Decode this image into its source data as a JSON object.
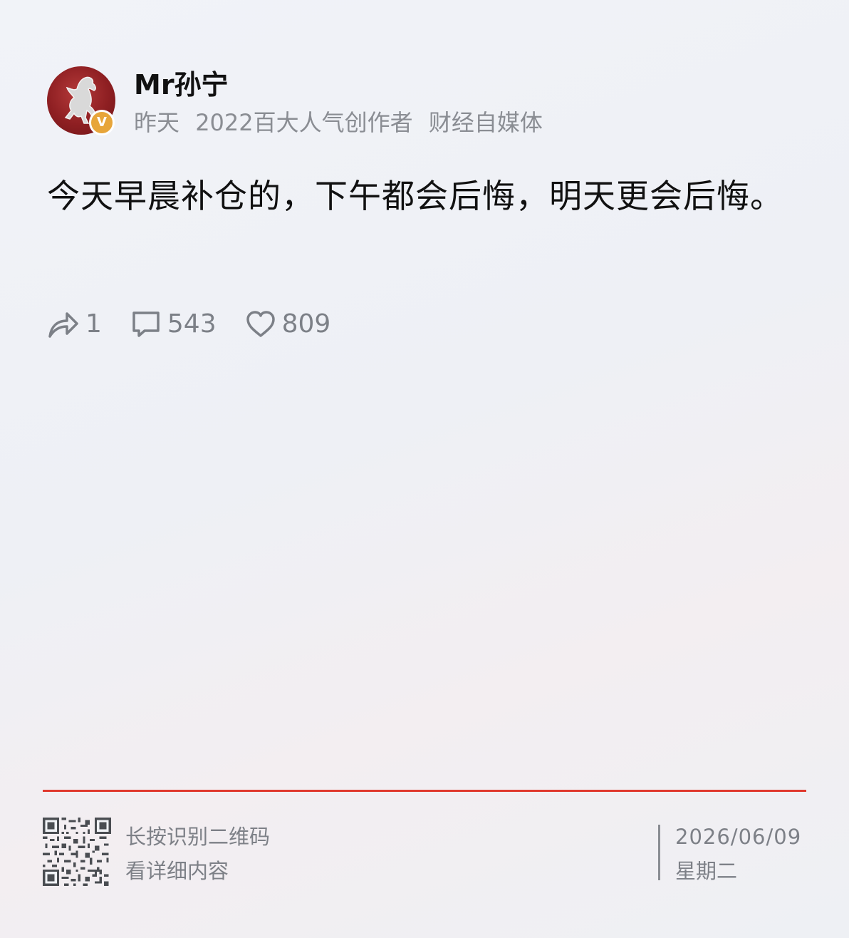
{
  "author": {
    "name": "Mr孙宁",
    "verified_badge": "V",
    "avatar_icon": "horse-emblem-icon"
  },
  "meta": {
    "time": "昨天",
    "title_badge": "2022百大人气创作者",
    "category": "财经自媒体"
  },
  "post": {
    "text": "今天早晨补仓的，下午都会后悔，明天更会后悔。"
  },
  "actions": {
    "repost": {
      "icon": "share-arrow-icon",
      "count": "1"
    },
    "comment": {
      "icon": "comment-bubble-icon",
      "count": "543"
    },
    "like": {
      "icon": "heart-icon",
      "count": "809"
    }
  },
  "footer": {
    "qr_line1": "长按识别二维码",
    "qr_line2": "看详细内容",
    "date": "2026/06/09",
    "weekday": "星期二"
  },
  "colors": {
    "divider": "#e0392e",
    "verified": "#e7a53a",
    "muted_text": "#8a8d93"
  }
}
